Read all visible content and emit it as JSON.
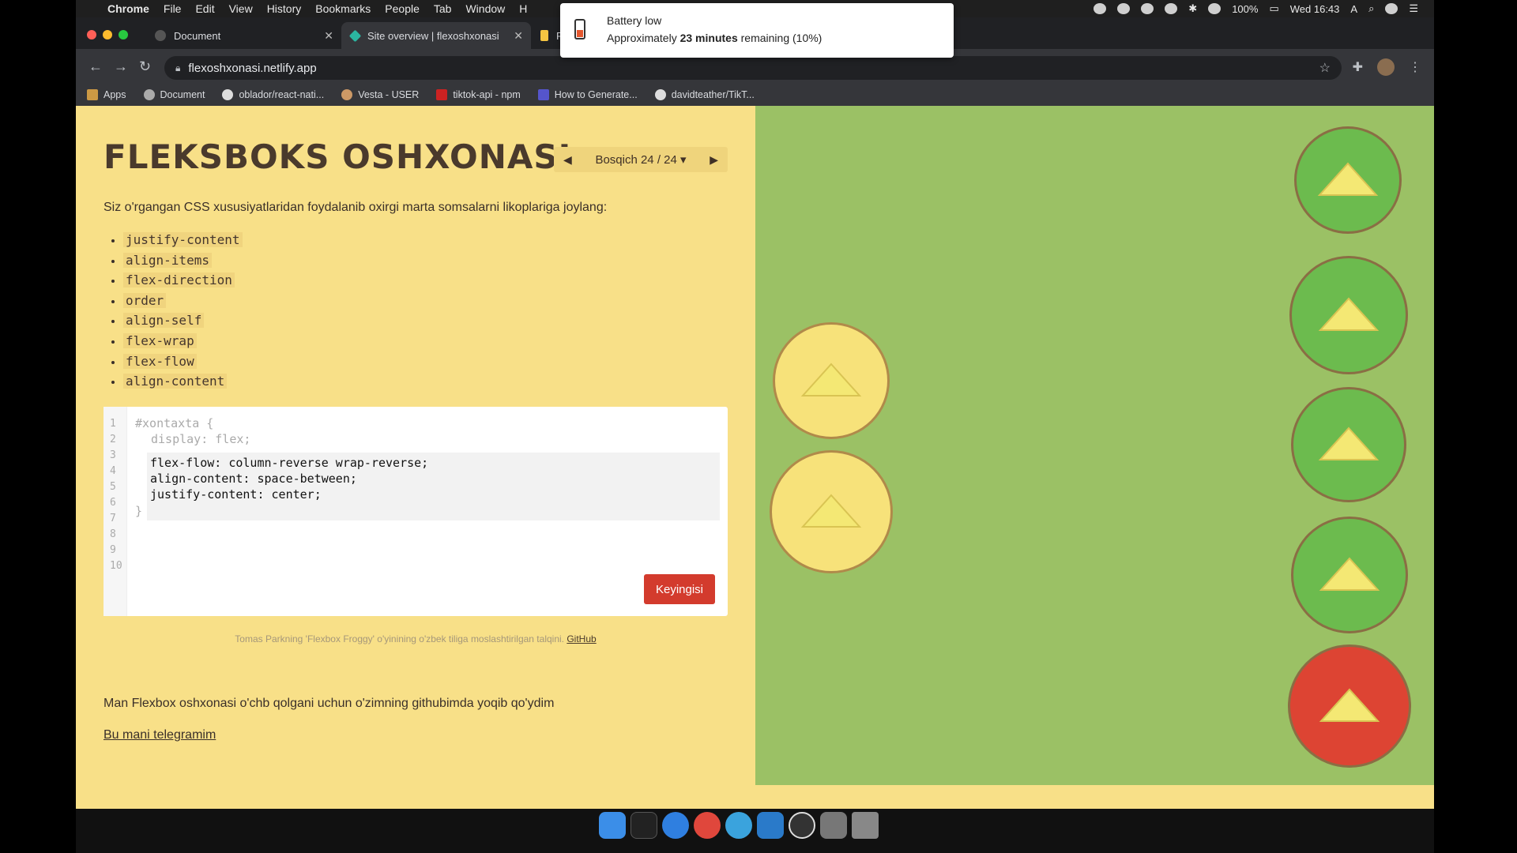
{
  "menubar": {
    "app_name": "Chrome",
    "items": [
      "File",
      "Edit",
      "View",
      "History",
      "Bookmarks",
      "People",
      "Tab",
      "Window",
      "H"
    ],
    "battery": "100%",
    "clock": "Wed 16:43"
  },
  "tabs": [
    {
      "title": "Document"
    },
    {
      "title": "Site overview | flexoshxonasi"
    },
    {
      "title": "F"
    }
  ],
  "address": {
    "url": "flexoshxonasi.netlify.app"
  },
  "bookmarks": [
    "Apps",
    "Document",
    "oblador/react-nati...",
    "Vesta - USER",
    "tiktok-api - npm",
    "How to Generate...",
    "davidteather/TikT..."
  ],
  "notification": {
    "title": "Battery low",
    "prefix": "Approximately ",
    "bold": "23 minutes",
    "suffix": " remaining (10%)"
  },
  "game": {
    "title": "FLEKSBOKS OSHXONASI",
    "level_label": "Bosqich 24 / 24 ▾",
    "instructions": "Siz o'rgangan CSS xususiyatlaridan foydalanib oxirgi marta somsalarni likoplariga joylang:",
    "properties": [
      "justify-content",
      "align-items",
      "flex-direction",
      "order",
      "align-self",
      "flex-wrap",
      "flex-flow",
      "align-content"
    ],
    "line_numbers": [
      "1",
      "2",
      "3",
      "4",
      "5",
      "6",
      "7",
      "8",
      "9",
      "10"
    ],
    "code_before": [
      "#xontaxta {",
      "display: flex;"
    ],
    "code_input": [
      "flex-flow: column-reverse wrap-reverse;",
      "align-content: space-between;",
      "justify-content: center;"
    ],
    "code_after": "}",
    "next_button": "Keyingisi",
    "credit_text": "Tomas Parkning 'Flexbox Froggy' o'yinining o'zbek tiliga moslashtirilgan talqini.",
    "credit_link": "GitHub",
    "message": "Man Flexbox oshxonasi o'chb qolgani uchun o'zimning githubimda yoqib qo'ydim",
    "telegram_link": "Bu mani telegramim"
  },
  "colors": {
    "page_bg": "#f8e088",
    "board_bg": "#9bc165",
    "green_plate": "#6cbb4e",
    "red_plate": "#dd4433",
    "samsa": "#f4e874",
    "button": "#d33b2d"
  }
}
